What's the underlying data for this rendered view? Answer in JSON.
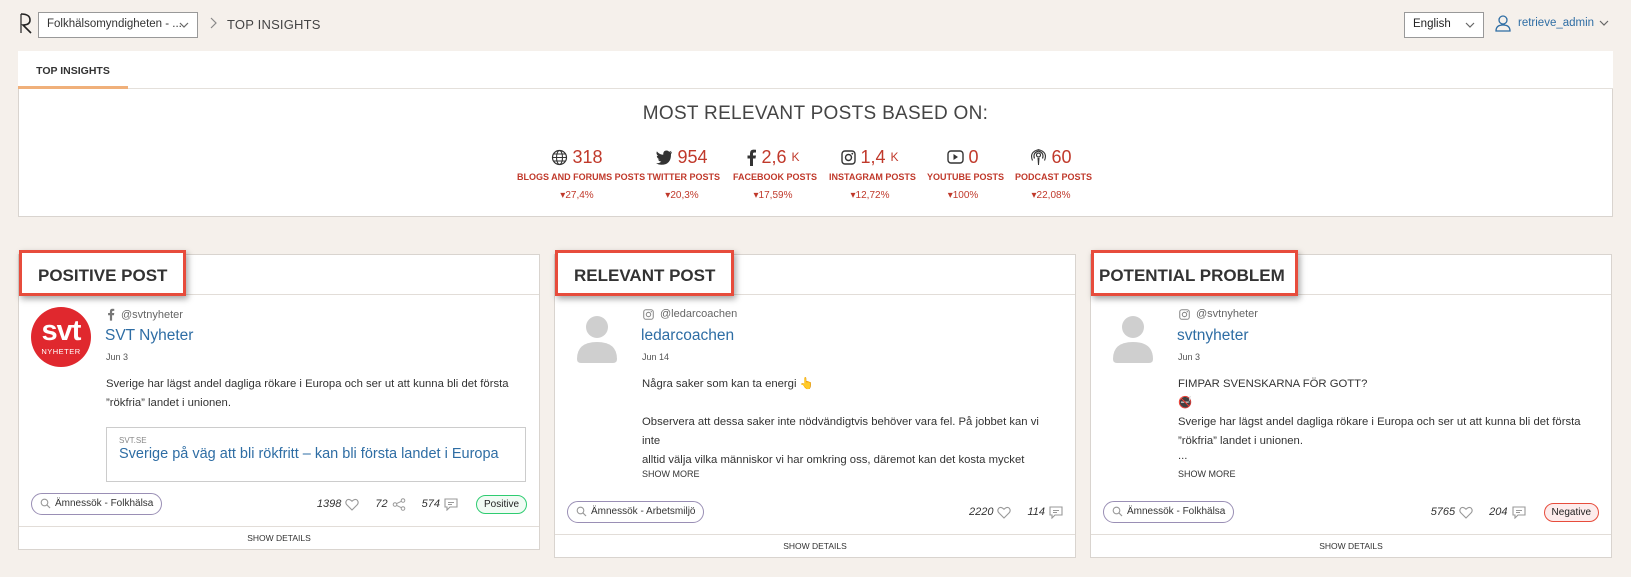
{
  "header": {
    "org_select": "Folkhälsomyndigheten - ...",
    "breadcrumb": "TOP INSIGHTS",
    "language": "English",
    "user": "retrieve_admin"
  },
  "tabs": [
    {
      "label": "TOP INSIGHTS",
      "active": true
    }
  ],
  "summary": {
    "title": "MOST RELEVANT POSTS BASED ON:",
    "stats": [
      {
        "icon": "globe-icon",
        "value": "318",
        "unit": "",
        "label": "BLOGS AND FORUMS POSTS",
        "delta": "27,4%"
      },
      {
        "icon": "twitter-icon",
        "value": "954",
        "unit": "",
        "label": "TWITTER POSTS",
        "delta": "20,3%"
      },
      {
        "icon": "facebook-icon",
        "value": "2,6",
        "unit": "K",
        "label": "FACEBOOK POSTS",
        "delta": "17,59%"
      },
      {
        "icon": "instagram-icon",
        "value": "1,4",
        "unit": "K",
        "label": "INSTAGRAM POSTS",
        "delta": "12,72%"
      },
      {
        "icon": "youtube-icon",
        "value": "0",
        "unit": "",
        "label": "YOUTUBE POSTS",
        "delta": "100%"
      },
      {
        "icon": "podcast-icon",
        "value": "60",
        "unit": "",
        "label": "PODCAST POSTS",
        "delta": "22,08%"
      }
    ]
  },
  "cards": [
    {
      "title": "POSITIVE POST",
      "avatar_text": "svt",
      "avatar_sub": "NYHETER",
      "platform": "facebook-icon",
      "handle": "@svtnyheter",
      "name": "SVT Nyheter",
      "date": "Jun 3",
      "text": [
        "Sverige har lägst andel dagliga rökare i Europa och ser ut att kunna bli det första",
        "”rökfria” landet i unionen."
      ],
      "preview_source": "SVT.SE",
      "preview_title": "Sverige på väg att bli rökfritt – kan bli första landet i Europa",
      "chip": "Ämnessök - Folkhälsa",
      "likes": "1398",
      "shares": "72",
      "comments": "574",
      "sentiment": "Positive",
      "show_details": "SHOW DETAILS"
    },
    {
      "title": "RELEVANT POST",
      "platform": "instagram-icon",
      "handle": "@ledarcoachen",
      "name": "ledarcoachen",
      "date": "Jun 14",
      "text": [
        "Några saker som kan ta energi 👆",
        "",
        "Observera att dessa saker inte nödvändigtvis behöver vara fel. På jobbet kan vi inte",
        "alltid välja vilka människor vi har omkring oss, däremot kan det kosta mycket energi",
        "..."
      ],
      "show_more": "SHOW MORE",
      "chip": "Ämnessök - Arbetsmiljö",
      "likes": "2220",
      "comments": "114",
      "show_details": "SHOW DETAILS"
    },
    {
      "title": "POTENTIAL PROBLEM",
      "platform": "instagram-icon",
      "handle": "@svtnyheter",
      "name": "svtnyheter",
      "date": "Jun 3",
      "text": [
        "FIMPAR SVENSKARNA FÖR GOTT?",
        "🚭",
        "Sverige har lägst andel dagliga rökare i Europa och ser ut att kunna bli det första",
        "”rökfria” landet i unionen.",
        "..."
      ],
      "show_more": "SHOW MORE",
      "chip": "Ämnessök - Folkhälsa",
      "likes": "5765",
      "comments": "204",
      "sentiment": "Negative",
      "show_details": "SHOW DETAILS"
    }
  ],
  "colors": {
    "accent": "#c0392b",
    "link": "#2e6da4",
    "highlight": "#e74c3c",
    "tab_underline": "#f0b07a"
  }
}
